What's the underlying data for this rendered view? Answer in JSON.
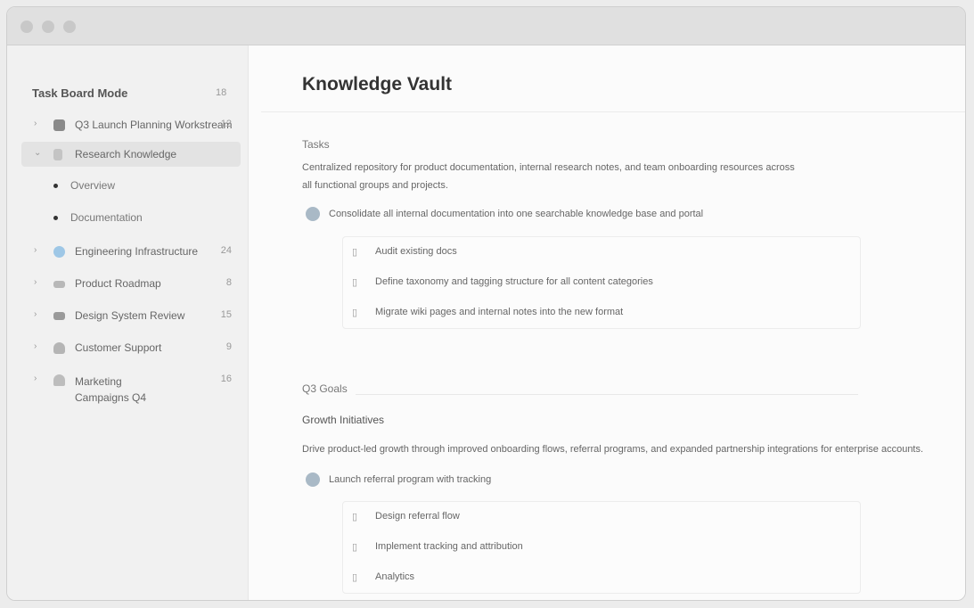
{
  "window": {
    "traffic_lights": [
      "close",
      "minimize",
      "maximize"
    ]
  },
  "sidebar": {
    "title": "Task Board Mode",
    "title_count": "18",
    "items": [
      {
        "label": "Q3 Launch Planning Workstream",
        "count": "12",
        "icon": "grid-icon",
        "color": "#8a8a8a",
        "chevron": "›"
      },
      {
        "label": "Research Knowledge",
        "count": "",
        "icon": "doc-icon",
        "color": "#b0b0b0",
        "chevron": "⌄"
      },
      {
        "label": "Engineering Infrastructure",
        "count": "24",
        "icon": "globe-icon",
        "color": "#9ec7e6",
        "chevron": "›"
      },
      {
        "label": "Product Roadmap",
        "count": "8",
        "icon": "chart-icon",
        "color": "#b8b8b8",
        "chevron": "›"
      },
      {
        "label": "Design System Review",
        "count": "15",
        "icon": "palette-icon",
        "color": "#9a9a9a",
        "chevron": "›"
      },
      {
        "label": "Customer Support",
        "count": "9",
        "icon": "user-icon",
        "color": "#b5b5b5",
        "chevron": "›"
      },
      {
        "label": "Marketing Campaigns Q4",
        "count": "16",
        "icon": "bell-icon",
        "color": "#bdbdbd",
        "chevron": "›"
      }
    ],
    "subitems": [
      "Overview",
      "Documentation"
    ]
  },
  "main": {
    "title": "Knowledge Vault",
    "sections": [
      {
        "label": "Tasks",
        "paragraph": "Centralized repository for product documentation, internal research notes, and team onboarding resources across all functional groups and projects.",
        "task": "Consolidate all internal documentation into one searchable knowledge base and portal",
        "subtasks": [
          "Audit existing docs",
          "Define taxonomy and tagging structure for all content categories",
          "Migrate wiki pages and internal notes into the new format"
        ]
      },
      {
        "label": "Q3 Goals",
        "heading": "Growth Initiatives",
        "paragraph": "Drive product-led growth through improved onboarding flows, referral programs, and expanded partnership integrations for enterprise accounts.",
        "task": "Launch referral program with tracking",
        "subtasks": [
          "Design referral flow",
          "Implement tracking and attribution",
          "Analytics"
        ]
      }
    ]
  }
}
